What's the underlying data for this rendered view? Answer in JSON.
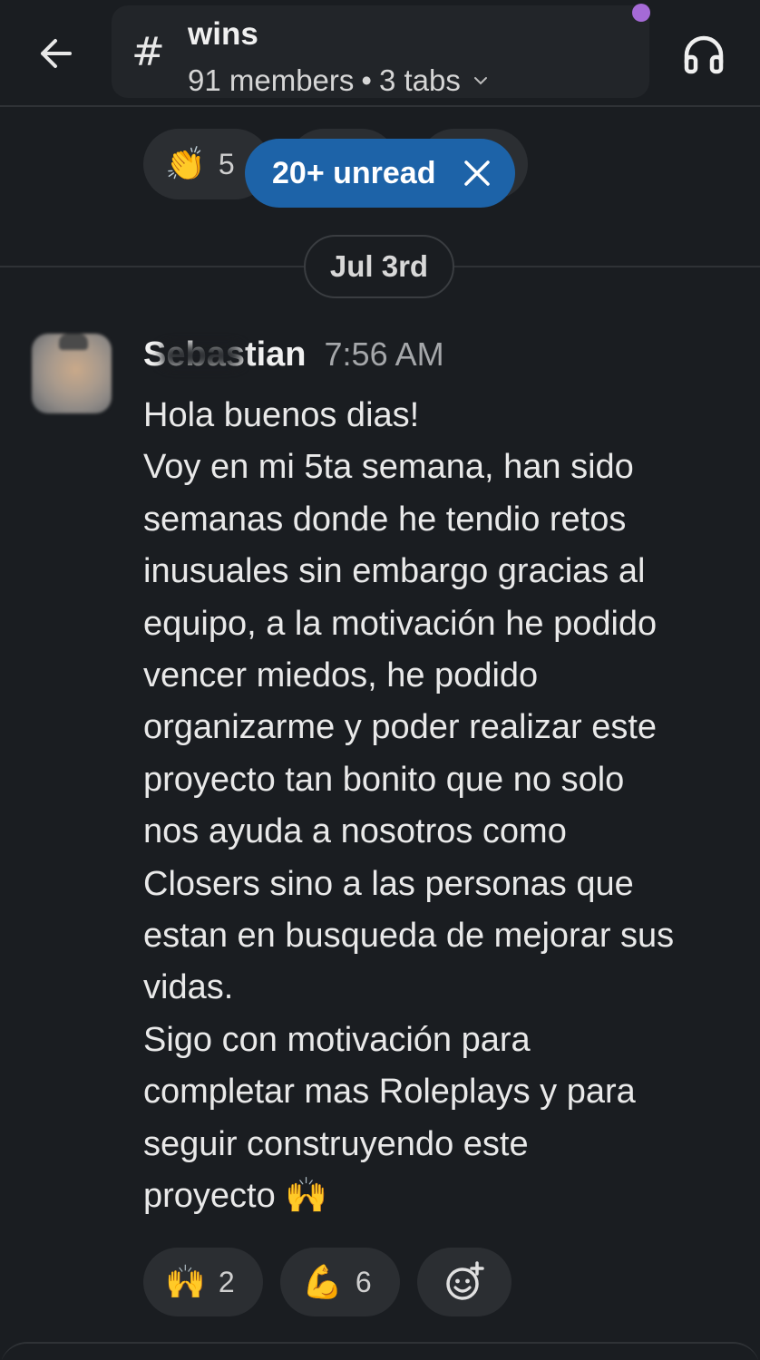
{
  "header": {
    "channel_name": "wins",
    "hash_symbol": "#",
    "members": "91 members",
    "separator": "•",
    "tabs": "3 tabs",
    "accent_dot_color": "#a56ad6"
  },
  "top_reactions": {
    "first": {
      "emoji": "👏",
      "count": "5",
      "icon": "clapping-hands-icon"
    }
  },
  "unread_banner": {
    "label": "20+ unread",
    "close_icon": "close-icon",
    "color": "#1d63a8"
  },
  "date_divider": {
    "label": "Jul 3rd"
  },
  "message": {
    "author": "Sebastian",
    "time": "7:56 AM",
    "lines": [
      "Hola buenos dias!",
      "Voy en mi 5ta semana, han sido",
      "semanas donde he tendio retos",
      "inusuales sin embargo gracias al",
      "equipo, a la motivación he podido",
      "vencer miedos, he podido",
      "organizarme y poder realizar este",
      "proyecto tan bonito que no solo",
      "nos ayuda a nosotros como",
      "Closers sino a las personas que",
      "estan en busqueda de mejorar sus",
      "vidas.",
      "Sigo con motivación para",
      "completar mas Roleplays y para",
      "seguir construyendo este",
      "proyecto 🙌"
    ]
  },
  "reactions": [
    {
      "emoji": "🙌",
      "count": "2",
      "icon": "raising-hands-icon"
    },
    {
      "emoji": "💪",
      "count": "6",
      "icon": "flexed-biceps-icon"
    }
  ],
  "add_reaction": {
    "icon": "add-reaction-icon"
  }
}
